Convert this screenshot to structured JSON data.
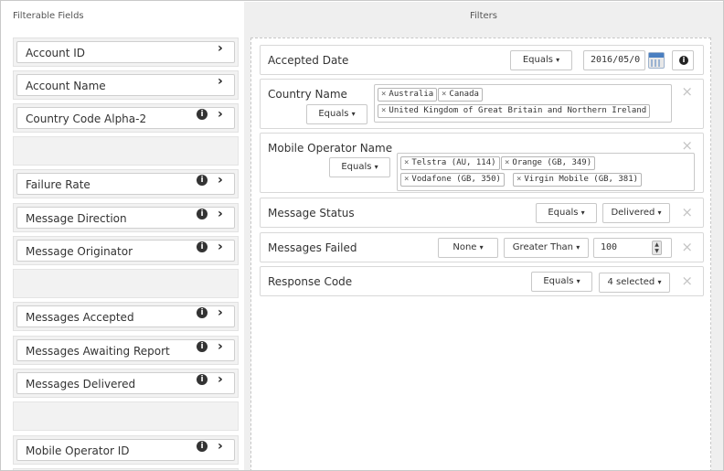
{
  "header": {
    "left": "Filterable Fields",
    "right": "Filters"
  },
  "fields": [
    {
      "label": "Account ID",
      "info": false
    },
    {
      "label": "Account Name",
      "info": false
    },
    {
      "label": "Country Code Alpha-2",
      "info": true
    },
    {
      "label": "",
      "placeholder": true
    },
    {
      "label": "Failure Rate",
      "info": true
    },
    {
      "label": "Message Direction",
      "info": true
    },
    {
      "label": "Message Originator",
      "info": true
    },
    {
      "label": "",
      "placeholder": true
    },
    {
      "label": "Messages Accepted",
      "info": true
    },
    {
      "label": "Messages Awaiting Report",
      "info": true
    },
    {
      "label": "Messages Delivered",
      "info": true
    },
    {
      "label": "",
      "placeholder": true
    },
    {
      "label": "Mobile Operator ID",
      "info": true
    }
  ],
  "icons": {
    "info": "i",
    "chevron": "›",
    "remove": "×",
    "caret": "▾"
  },
  "filters": {
    "accepted_date": {
      "name": "Accepted Date",
      "operator": "Equals",
      "value": "2016/05/0"
    },
    "country_name": {
      "name": "Country Name",
      "operator": "Equals",
      "tags": [
        "Australia",
        "Canada",
        "United Kingdom of Great Britain and Northern Ireland"
      ]
    },
    "mobile_operator": {
      "name": "Mobile Operator Name",
      "operator": "Equals",
      "tags": [
        "Telstra (AU, 114)",
        "Orange (GB, 349)",
        "Vodafone (GB, 350)",
        "Virgin Mobile (GB, 381)"
      ]
    },
    "message_status": {
      "name": "Message Status",
      "operator": "Equals",
      "value": "Delivered"
    },
    "messages_failed": {
      "name": "Messages Failed",
      "aggregate": "None",
      "operator": "Greater Than",
      "value": "100"
    },
    "response_code": {
      "name": "Response Code",
      "operator": "Equals",
      "value": "4 selected"
    }
  }
}
